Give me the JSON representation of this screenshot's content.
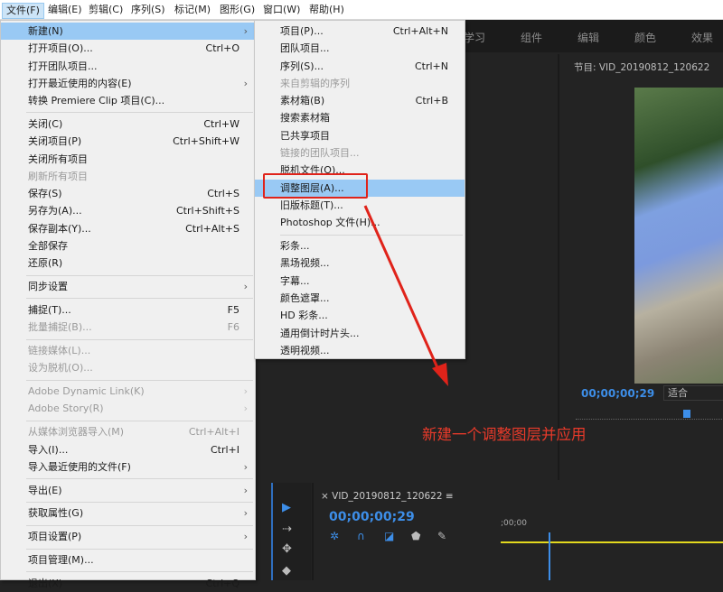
{
  "menubar": [
    "文件(F)",
    "编辑(E)",
    "剪辑(C)",
    "序列(S)",
    "标记(M)",
    "图形(G)",
    "窗口(W)",
    "帮助(H)"
  ],
  "workspace_tabs": [
    "学习",
    "组件",
    "编辑",
    "颜色",
    "效果"
  ],
  "file_menu": [
    {
      "label": "新建(N)",
      "submenu": true,
      "highlight": true
    },
    {
      "label": "打开项目(O)...",
      "shortcut": "Ctrl+O"
    },
    {
      "label": "打开团队项目..."
    },
    {
      "label": "打开最近使用的内容(E)",
      "submenu": true
    },
    {
      "label": "转换 Premiere Clip 项目(C)..."
    },
    {
      "sep": true
    },
    {
      "label": "关闭(C)",
      "shortcut": "Ctrl+W"
    },
    {
      "label": "关闭项目(P)",
      "shortcut": "Ctrl+Shift+W"
    },
    {
      "label": "关闭所有项目"
    },
    {
      "label": "刷新所有项目",
      "disabled": true
    },
    {
      "label": "保存(S)",
      "shortcut": "Ctrl+S"
    },
    {
      "label": "另存为(A)...",
      "shortcut": "Ctrl+Shift+S"
    },
    {
      "label": "保存副本(Y)...",
      "shortcut": "Ctrl+Alt+S"
    },
    {
      "label": "全部保存"
    },
    {
      "label": "还原(R)"
    },
    {
      "sep": true
    },
    {
      "label": "同步设置",
      "submenu": true
    },
    {
      "sep": true
    },
    {
      "label": "捕捉(T)...",
      "shortcut": "F5"
    },
    {
      "label": "批量捕捉(B)...",
      "shortcut": "F6",
      "disabled": true
    },
    {
      "sep": true
    },
    {
      "label": "链接媒体(L)...",
      "disabled": true
    },
    {
      "label": "设为脱机(O)...",
      "disabled": true
    },
    {
      "sep": true
    },
    {
      "label": "Adobe Dynamic Link(K)",
      "submenu": true,
      "disabled": true
    },
    {
      "label": "Adobe Story(R)",
      "submenu": true,
      "disabled": true
    },
    {
      "sep": true
    },
    {
      "label": "从媒体浏览器导入(M)",
      "shortcut": "Ctrl+Alt+I",
      "disabled": true
    },
    {
      "label": "导入(I)...",
      "shortcut": "Ctrl+I"
    },
    {
      "label": "导入最近使用的文件(F)",
      "submenu": true
    },
    {
      "sep": true
    },
    {
      "label": "导出(E)",
      "submenu": true
    },
    {
      "sep": true
    },
    {
      "label": "获取属性(G)",
      "submenu": true
    },
    {
      "sep": true
    },
    {
      "label": "项目设置(P)",
      "submenu": true
    },
    {
      "sep": true
    },
    {
      "label": "项目管理(M)..."
    },
    {
      "sep": true
    },
    {
      "label": "退出(X)",
      "shortcut": "Ctrl+Q"
    }
  ],
  "new_submenu": [
    {
      "label": "项目(P)...",
      "shortcut": "Ctrl+Alt+N"
    },
    {
      "label": "团队项目..."
    },
    {
      "label": "序列(S)...",
      "shortcut": "Ctrl+N"
    },
    {
      "label": "来自剪辑的序列",
      "disabled": true
    },
    {
      "label": "素材箱(B)",
      "shortcut": "Ctrl+B"
    },
    {
      "label": "搜索素材箱"
    },
    {
      "label": "已共享项目"
    },
    {
      "label": "链接的团队项目...",
      "disabled": true
    },
    {
      "label": "脱机文件(O)..."
    },
    {
      "label": "调整图层(A)...",
      "highlight": true
    },
    {
      "label": "旧版标题(T)..."
    },
    {
      "label": "Photoshop 文件(H)..."
    },
    {
      "sep": true
    },
    {
      "label": "彩条..."
    },
    {
      "label": "黑场视频..."
    },
    {
      "label": "字幕..."
    },
    {
      "label": "颜色遮罩..."
    },
    {
      "label": "HD 彩条..."
    },
    {
      "label": "通用倒计时片头..."
    },
    {
      "label": "透明视频..."
    }
  ],
  "program_monitor": {
    "title": "节目: VID_20190812_120622",
    "timecode": "00;00;00;29",
    "fit": "适合"
  },
  "timeline": {
    "title": "VID_20190812_120622",
    "timecode": "00;00;00;29",
    "ruler_start": ";00;00"
  },
  "annotation": {
    "text": "新建一个调整图层并应用",
    "color": "#e83a2a"
  },
  "colors": {
    "accent": "#3d8ee8",
    "highlight": "#99c9f4",
    "annotation": "#e0231a"
  }
}
